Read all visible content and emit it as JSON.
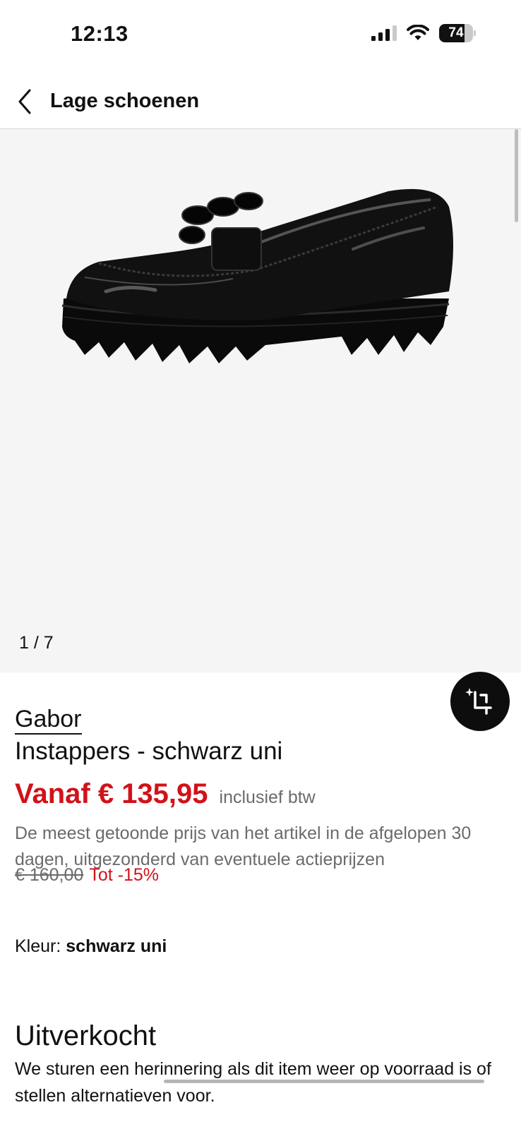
{
  "status_bar": {
    "time": "12:13",
    "battery_percent": 74,
    "battery_label": "74"
  },
  "nav": {
    "title": "Lage schoenen"
  },
  "gallery": {
    "page_indicator": "1 / 7",
    "current": 1,
    "total": 7
  },
  "product": {
    "brand": "Gabor",
    "name": "Instappers - schwarz uni",
    "price": "Vanaf € 135,95",
    "vat_label": "inclusief btw",
    "price_note": "De meest getoonde prijs van het artikel in de afgelopen 30 dagen, uitgezonderd van eventuele actieprijzen",
    "old_price": "€ 160,00",
    "discount": "Tot -15%",
    "color_label": "Kleur:",
    "color_value": "schwarz uni"
  },
  "availability": {
    "heading": "Uitverkocht",
    "text": "We sturen een herinnering als dit item weer op voorraad is of stellen alternatieven voor."
  },
  "icons": {
    "back": "chevron-left-icon",
    "signal": "cellular-signal-icon",
    "wifi": "wifi-icon",
    "battery": "battery-icon",
    "fab": "ai-crop-icon"
  },
  "colors": {
    "accent_red": "#d1121a",
    "gray_text": "#6b6b6b",
    "gallery_bg": "#f5f5f5"
  }
}
